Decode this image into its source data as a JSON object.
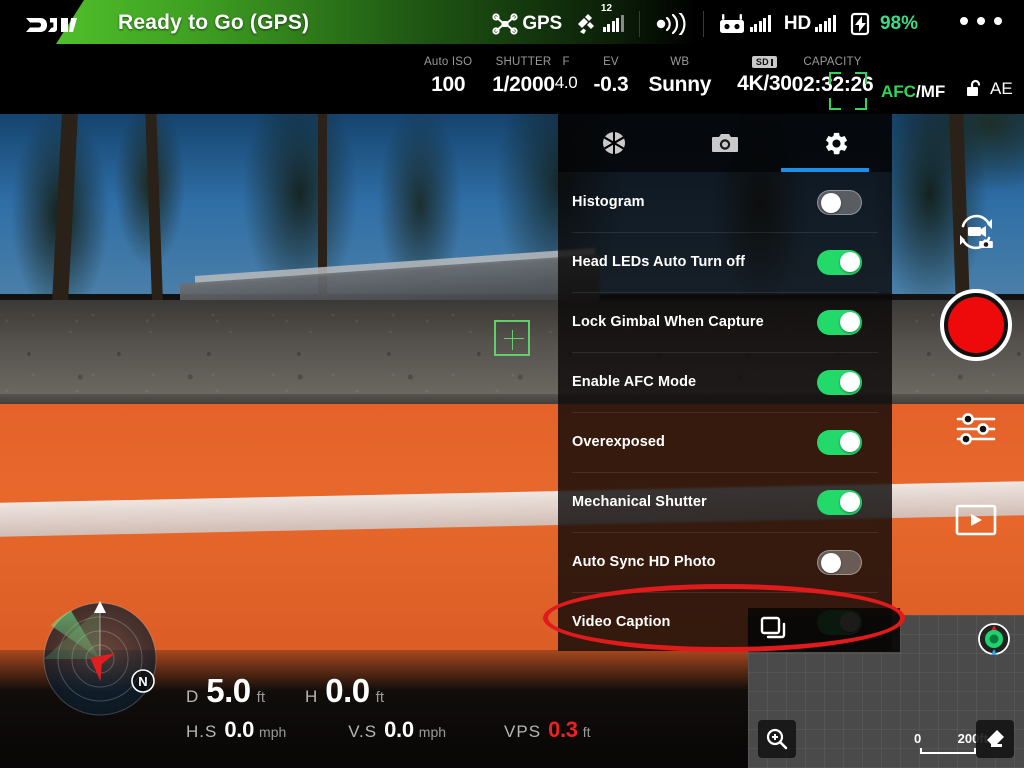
{
  "header": {
    "logo": "dji-logo",
    "flight_status": "Ready to Go (GPS)",
    "gps_label": "GPS",
    "satellite_count": "12",
    "hd_label": "HD",
    "battery_percent": "98%",
    "timer": "--:--",
    "more_menu": "more-options",
    "icons": {
      "drone": "drone-icon",
      "satellite": "satellite-icon",
      "signal": "signal-bars-icon",
      "rc_signal": "remote-signal-icon",
      "controller": "remote-controller-icon",
      "hd_signal": "hd-signal-icon",
      "battery": "battery-icon"
    }
  },
  "camera_params": [
    {
      "label": "Auto ISO",
      "value": "100",
      "name": "iso"
    },
    {
      "label": "SHUTTER",
      "value": "1/2000",
      "name": "shutter"
    },
    {
      "label": "F",
      "value": "4.0",
      "name": "aperture"
    },
    {
      "label": "EV",
      "value": "-0.3",
      "name": "ev"
    },
    {
      "label": "WB",
      "value": "Sunny",
      "name": "white-balance"
    }
  ],
  "storage": {
    "sd_badge": "SD",
    "resolution": "4K/30",
    "capacity_label": "CAPACITY",
    "capacity_value": "02:32:26"
  },
  "focus": {
    "afc_label": "AFC",
    "separator": "/",
    "mf_label": "MF",
    "ae_label": "AE",
    "lock_icon": "unlocked-padlock-icon"
  },
  "settings_panel": {
    "tabs": [
      {
        "name": "tab-aperture",
        "icon": "aperture-icon",
        "active": false
      },
      {
        "name": "tab-camera",
        "icon": "camera-icon",
        "active": false
      },
      {
        "name": "tab-general",
        "icon": "gear-icon",
        "active": true
      }
    ],
    "rows": [
      {
        "label": "Histogram",
        "state": "off",
        "name": "histogram"
      },
      {
        "label": "Head LEDs Auto Turn off",
        "state": "on",
        "name": "head-leds-auto-turn-off"
      },
      {
        "label": "Lock Gimbal When Capture",
        "state": "on",
        "name": "lock-gimbal-when-capture"
      },
      {
        "label": "Enable AFC Mode",
        "state": "on",
        "name": "enable-afc-mode"
      },
      {
        "label": "Overexposed",
        "state": "on",
        "name": "overexposed"
      },
      {
        "label": "Mechanical Shutter",
        "state": "on",
        "name": "mechanical-shutter"
      },
      {
        "label": "Auto Sync HD Photo",
        "state": "off",
        "name": "auto-sync-hd-photo"
      },
      {
        "label": "Video Caption",
        "state": "on",
        "name": "video-caption"
      }
    ],
    "highlighted_row": "Video Caption"
  },
  "right_sidebar": [
    {
      "name": "switch-photo-video-button",
      "icon": "camera-video-switch-icon"
    },
    {
      "name": "record-button",
      "icon": "record-circle-icon"
    },
    {
      "name": "camera-settings-button",
      "icon": "sliders-icon"
    },
    {
      "name": "playback-button",
      "icon": "play-rectangle-icon"
    }
  ],
  "telemetry": {
    "distance": {
      "key": "D",
      "value": "5.0",
      "unit": "ft"
    },
    "height": {
      "key": "H",
      "value": "0.0",
      "unit": "ft"
    },
    "horizontal_speed": {
      "key": "H.S",
      "value": "0.0",
      "unit": "mph"
    },
    "vertical_speed": {
      "key": "V.S",
      "value": "0.0",
      "unit": "mph"
    },
    "vps": {
      "key": "VPS",
      "value": "0.3",
      "unit": "ft"
    }
  },
  "radar": {
    "name": "attitude-radar",
    "north_label": "N"
  },
  "minimap": {
    "zoom_icon": "zoom-in-magnifier-icon",
    "erase_icon": "eraser-icon",
    "pin_icon": "aircraft-location-pin-icon",
    "scale_min": "0",
    "scale_max": "200ft"
  },
  "colors": {
    "accent_green": "#22d96a",
    "status_green": "#4fbf2a",
    "battery_green": "#3ddc84",
    "record_red": "#ee0a0a",
    "highlight_red": "#e01b1b",
    "tab_blue": "#1e8fe8",
    "alert_red": "#ee2222",
    "focus_green": "#2fd657"
  }
}
